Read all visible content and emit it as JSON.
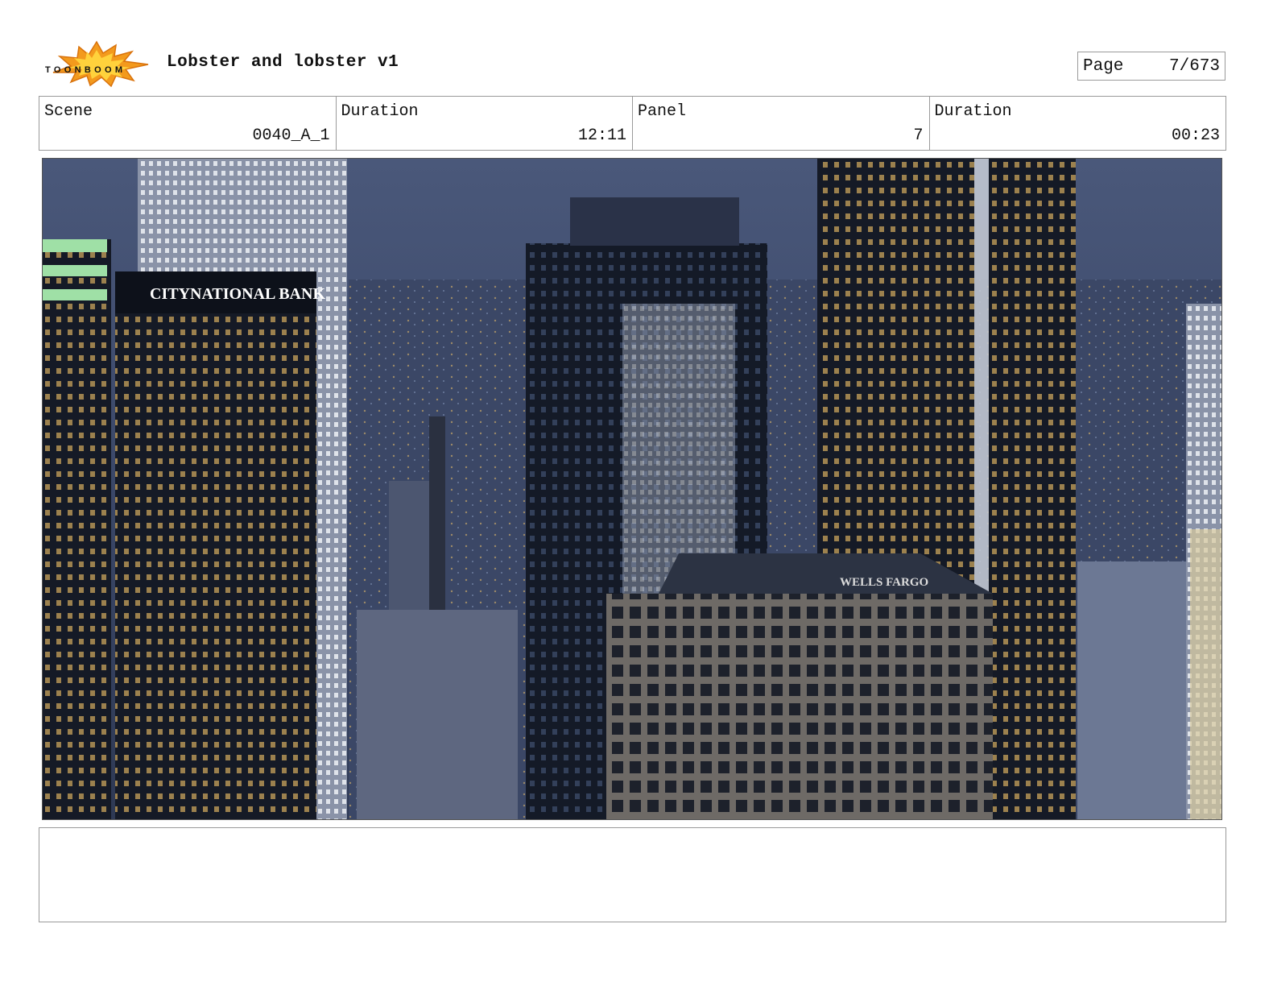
{
  "header": {
    "logo_text": "TOONBOOM",
    "title": "Lobster and lobster v1",
    "page_label": "Page",
    "page_value": "7/673"
  },
  "info": {
    "scene_label": "Scene",
    "scene_value": "0040_A_1",
    "duration_label": "Duration",
    "duration_value": "12:11",
    "panel_label": "Panel",
    "panel_value": "7",
    "panel_duration_label": "Duration",
    "panel_duration_value": "00:23"
  },
  "panel_image": {
    "building_signs": [
      "CITYNATIONAL BANK",
      "WELLS FARGO"
    ]
  },
  "notes": {
    "text": ""
  }
}
